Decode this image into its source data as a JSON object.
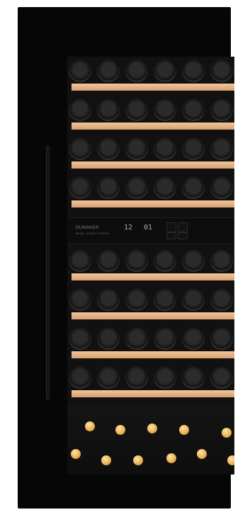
{
  "appliance": {
    "brand_line1": "DUNAVOX",
    "brand_line2": "WINE CONDITIONER",
    "temp_upper": "12",
    "temp_lower": "01"
  },
  "colors": {
    "body": "#060606",
    "shelf_wood": "#e4ad7e",
    "cap_gold": "#e7b04f"
  }
}
